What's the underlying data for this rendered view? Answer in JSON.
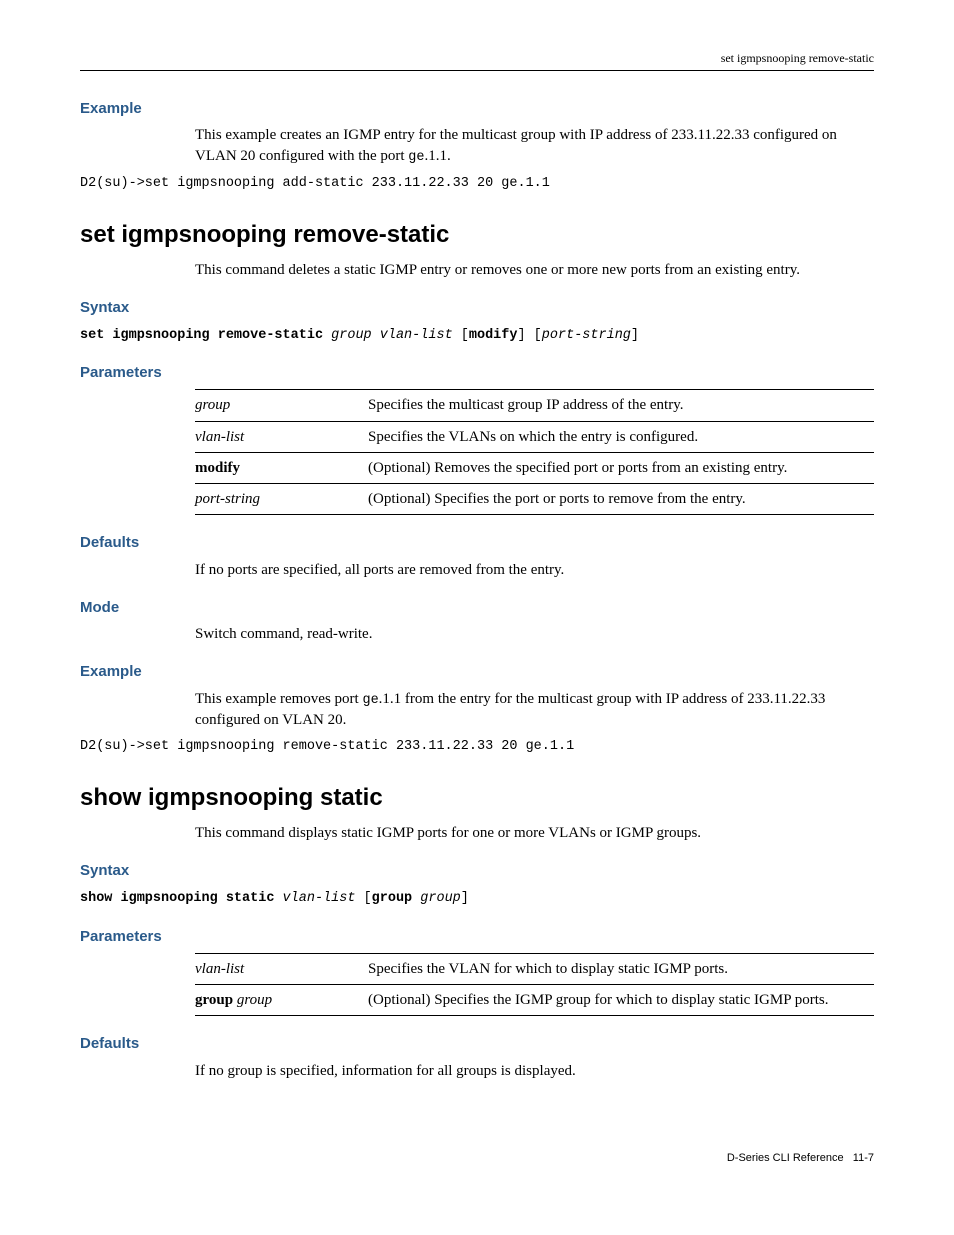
{
  "running_header": "set igmpsnooping remove-static",
  "sec1": {
    "example_h": "Example",
    "example_p1_a": "This example creates an IGMP entry for the multicast group with IP address of 233.11.22.33 configured on VLAN 20 configured with the port ",
    "example_p1_code": "ge",
    "example_p1_b": ".1.1.",
    "code": "D2(su)->set igmpsnooping add-static 233.11.22.33 20 ge.1.1"
  },
  "cmd1": {
    "title": "set igmpsnooping remove-static",
    "desc": "This command deletes a static IGMP entry or removes one or more new ports from an existing entry.",
    "syntax_h": "Syntax",
    "syntax": {
      "b1": "set igmpsnooping remove-static",
      "i1": " group vlan-list",
      "p1": " [",
      "b2": "modify",
      "p2": "] [",
      "i2": "port-string",
      "p3": "]"
    },
    "params_h": "Parameters",
    "params": [
      {
        "k_i": "group",
        "v": "Specifies the multicast group IP address of the entry."
      },
      {
        "k_i": "vlan-list",
        "v": "Specifies the VLANs on which the entry is configured."
      },
      {
        "k_b": "modify",
        "v": "(Optional) Removes the specified port or ports from an existing entry."
      },
      {
        "k_i": "port-string",
        "v": "(Optional) Specifies the port or ports to remove from the entry."
      }
    ],
    "defaults_h": "Defaults",
    "defaults_p": "If no ports are specified, all ports are removed from the entry.",
    "mode_h": "Mode",
    "mode_p": "Switch command, read-write.",
    "example_h": "Example",
    "example_p_a": "This example removes port ",
    "example_p_code": "ge",
    "example_p_b": ".1.1 from the entry for the multicast group with IP address of 233.11.22.33 configured on VLAN 20.",
    "code": "D2(su)->set igmpsnooping remove-static 233.11.22.33 20 ge.1.1"
  },
  "cmd2": {
    "title": "show igmpsnooping static",
    "desc": "This command displays static IGMP ports for one or more VLANs or IGMP groups.",
    "syntax_h": "Syntax",
    "syntax": {
      "b1": "show igmpsnooping static",
      "i1": " vlan-list",
      "p1": " [",
      "b2": "group",
      "i2": " group",
      "p2": "]"
    },
    "params_h": "Parameters",
    "params": [
      {
        "k_i": "vlan-list",
        "v": "Specifies the VLAN for which to display static IGMP ports."
      },
      {
        "k_b": "group",
        "k_i2": " group",
        "v": "(Optional) Specifies the IGMP group for which to display static IGMP ports."
      }
    ],
    "defaults_h": "Defaults",
    "defaults_p": "If no group is specified, information for all groups is displayed."
  },
  "footer_a": "D-Series CLI Reference",
  "footer_b": "11-7"
}
